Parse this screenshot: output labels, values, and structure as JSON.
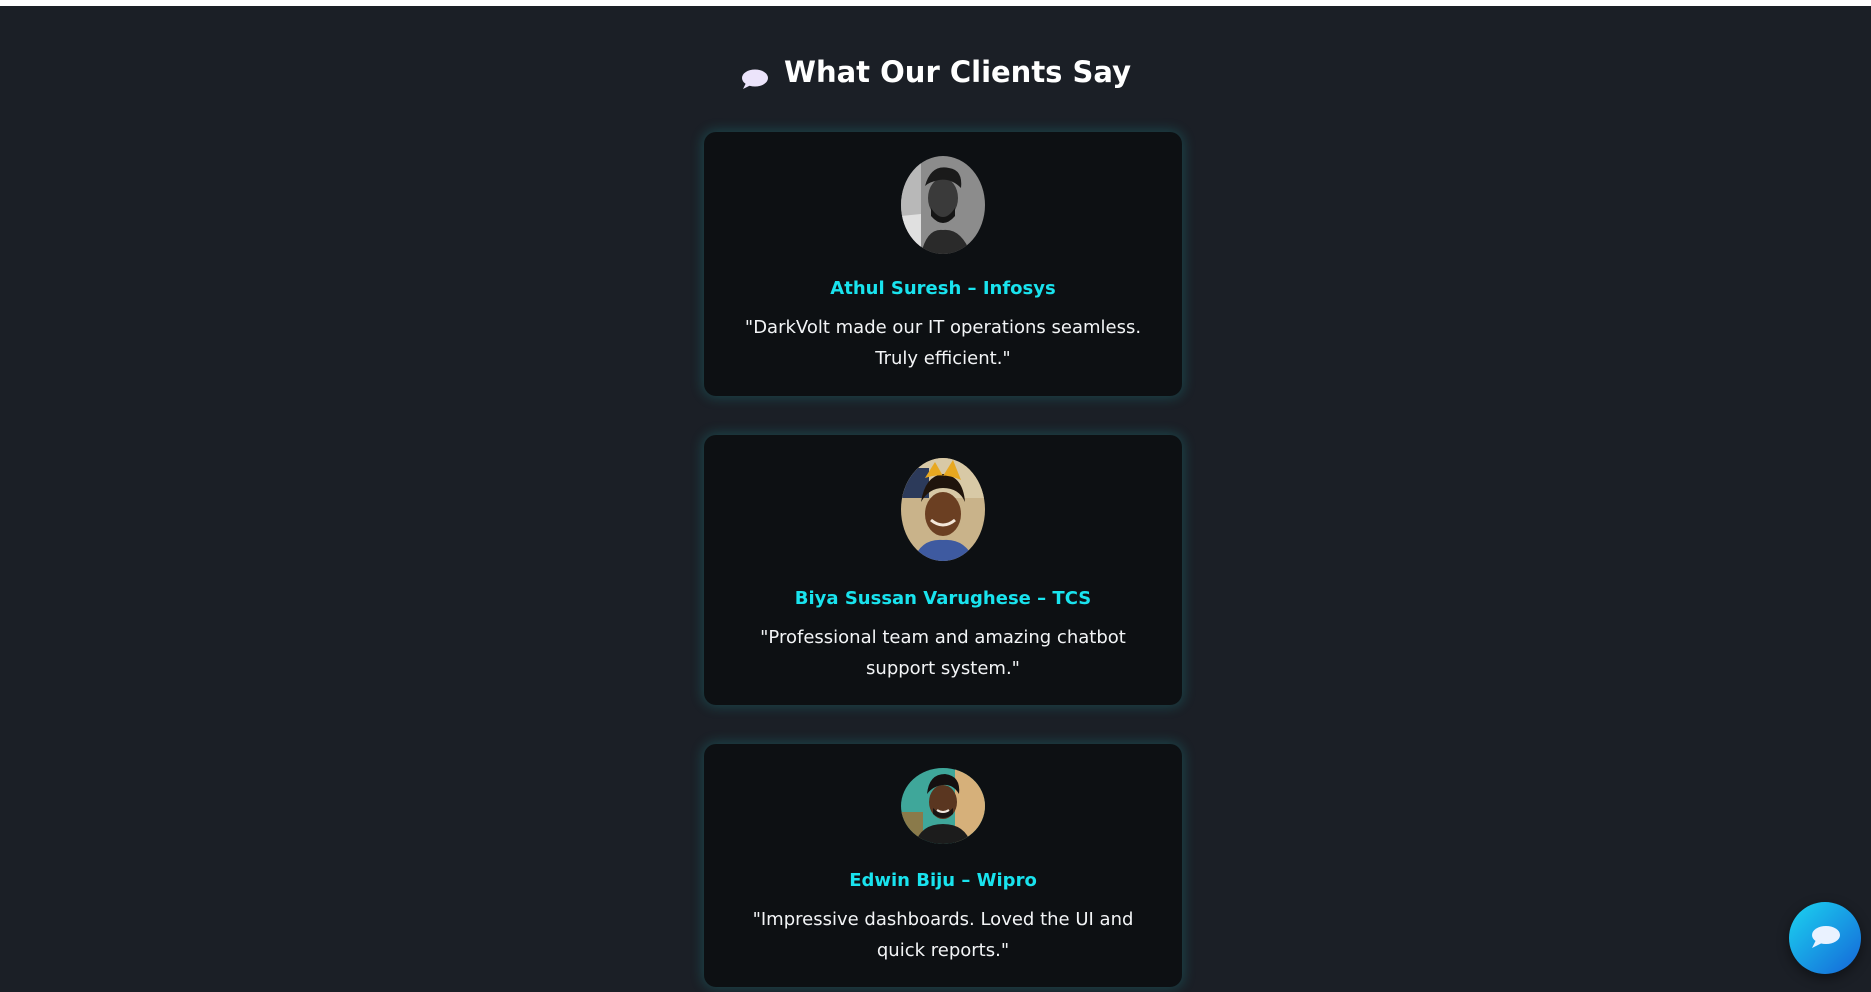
{
  "page": {
    "heading": "What Our Clients Say",
    "heading_icon": "speech-bubble-icon"
  },
  "testimonials": [
    {
      "name": "Athul Suresh – Infosys",
      "quote": "\"DarkVolt made our IT operations seamless. Truly efficient.\"",
      "avatar": "avatar-photo"
    },
    {
      "name": "Biya Sussan Varughese – TCS",
      "quote": "\"Professional team and amazing chatbot support system.\"",
      "avatar": "avatar-photo"
    },
    {
      "name": "Edwin Biju – Wipro",
      "quote": "\"Impressive dashboards. Loved the UI and quick reports.\"",
      "avatar": "avatar-photo"
    }
  ],
  "chat_button": {
    "icon": "chat-bubble-icon"
  },
  "colors": {
    "background": "#1b1f26",
    "card": "#0d1013",
    "accent": "#19e3ee",
    "fab_start": "#1bd4f0",
    "fab_end": "#1565d8"
  }
}
